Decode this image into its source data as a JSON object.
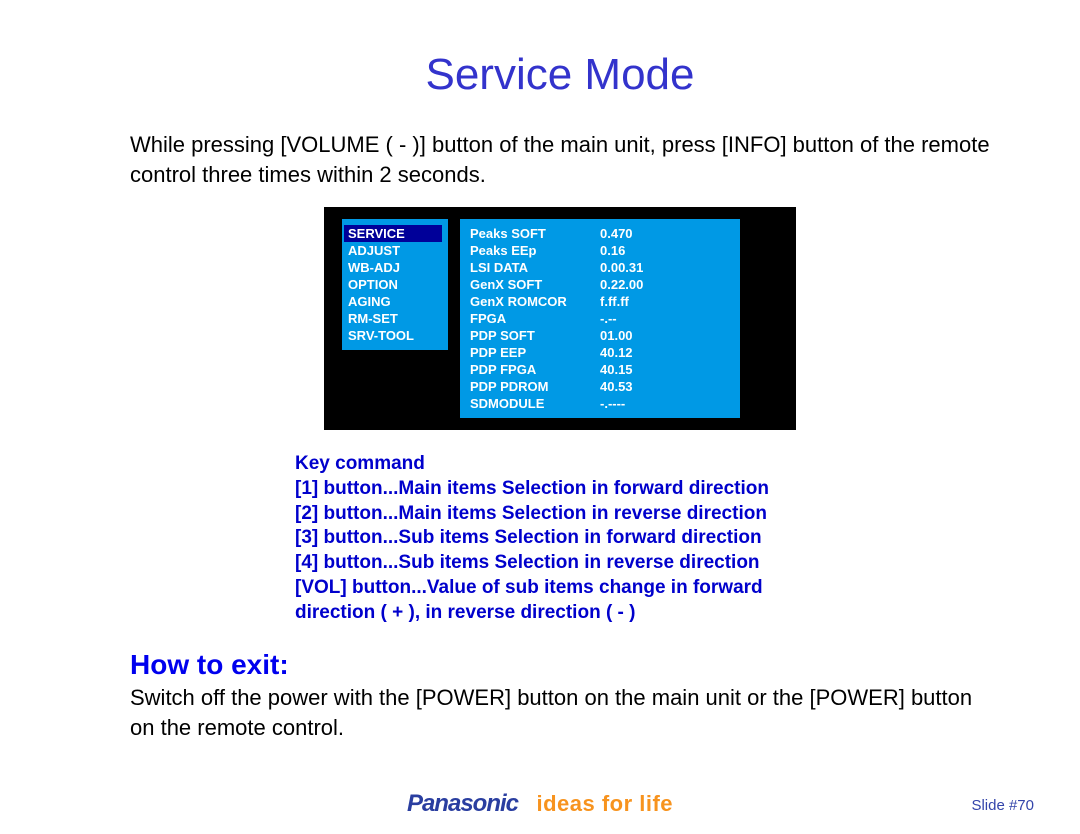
{
  "title": "Service Mode",
  "intro": "While pressing [VOLUME ( - )] button of the main unit, press [INFO] button of the remote control three times within 2 seconds.",
  "menu": [
    "SERVICE",
    "ADJUST",
    "WB-ADJ",
    "OPTION",
    "AGING",
    "RM-SET",
    "SRV-TOOL"
  ],
  "data_rows": [
    {
      "label": "Peaks SOFT",
      "value": "0.470"
    },
    {
      "label": "Peaks EEp",
      "value": "0.16"
    },
    {
      "label": "LSI DATA",
      "value": "0.00.31"
    },
    {
      "label": "GenX SOFT",
      "value": "0.22.00"
    },
    {
      "label": "GenX ROMCOR",
      "value": "f.ff.ff"
    },
    {
      "label": "FPGA",
      "value": "-.--"
    },
    {
      "label": "PDP SOFT",
      "value": "01.00"
    },
    {
      "label": "PDP EEP",
      "value": "40.12"
    },
    {
      "label": "PDP FPGA",
      "value": "40.15"
    },
    {
      "label": "PDP PDROM",
      "value": "40.53"
    },
    {
      "label": "SDMODULE",
      "value": "-.----"
    }
  ],
  "keycmd": {
    "heading": "Key command",
    "lines": [
      "[1] button...Main items Selection in forward direction",
      "[2] button...Main items Selection in reverse direction",
      "[3] button...Sub items Selection in forward direction",
      "[4] button...Sub items Selection in reverse direction",
      "[VOL] button...Value of sub items change in forward",
      "direction ( + ), in reverse direction ( - )"
    ]
  },
  "exit": {
    "heading": "How to exit:",
    "body": "Switch off the power with the [POWER] button on the main unit or the [POWER] button on the remote control."
  },
  "footer": {
    "brand": "Panasonic",
    "tagline": "ideas for life",
    "slide": "Slide #70"
  }
}
